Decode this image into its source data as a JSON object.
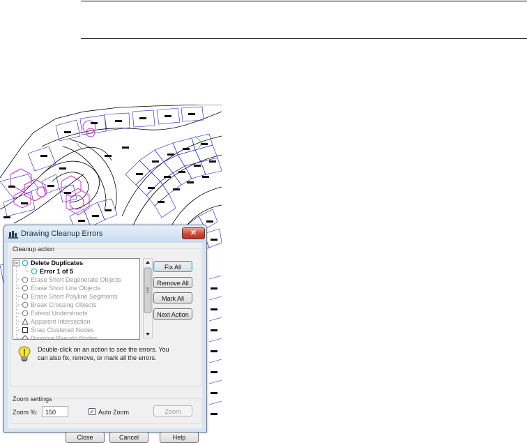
{
  "dialog": {
    "title": "Drawing Cleanup Errors",
    "close_glyph": "✕",
    "cleanup_group_label": "Cleanup action",
    "tree_items": [
      {
        "label": "Delete Duplicates",
        "icon": "circle-icon",
        "state": "expanded-bold"
      },
      {
        "label": "Error 1 of 5",
        "icon": "circle-icon",
        "state": "child-bold"
      },
      {
        "label": "Erase Short Degenerate Objects",
        "icon": "circle-icon",
        "state": "disabled"
      },
      {
        "label": "Erase Short Line Objects",
        "icon": "circle-icon",
        "state": "disabled"
      },
      {
        "label": "Erase Short Polyline Segments",
        "icon": "circle-icon",
        "state": "disabled"
      },
      {
        "label": "Break Crossing Objects",
        "icon": "circle-icon",
        "state": "disabled"
      },
      {
        "label": "Extend Undershoots",
        "icon": "circle-icon",
        "state": "disabled"
      },
      {
        "label": "Apparent Intersection",
        "icon": "triangle-icon",
        "state": "disabled"
      },
      {
        "label": "Snap Clustered Nodes",
        "icon": "square-icon",
        "state": "disabled"
      },
      {
        "label": "Dissolve Pseudo Nodes",
        "icon": "diamond-icon",
        "state": "disabled"
      }
    ],
    "buttons": {
      "fix_all": "Fix All",
      "remove_all": "Remove All",
      "mark_all": "Mark All",
      "next_action": "Next Action"
    },
    "hint": "Double-click on an action to see the errors. You can also fix, remove, or mark all the errors.",
    "zoom": {
      "group_label": "Zoom settings",
      "label": "Zoom %:",
      "value": "150",
      "auto_zoom_label": "Auto Zoom",
      "auto_zoom_checked": true,
      "zoom_button": "Zoom"
    },
    "footer": {
      "close": "Close",
      "cancel": "Cancel",
      "help": "Help"
    }
  },
  "colors": {
    "parcel_lines": "#1a1acc",
    "error_markers": "#cc33cc",
    "titlebar": "#d7e4f2",
    "close_button": "#c64a33",
    "selection_outline": "#2aa9d6"
  }
}
